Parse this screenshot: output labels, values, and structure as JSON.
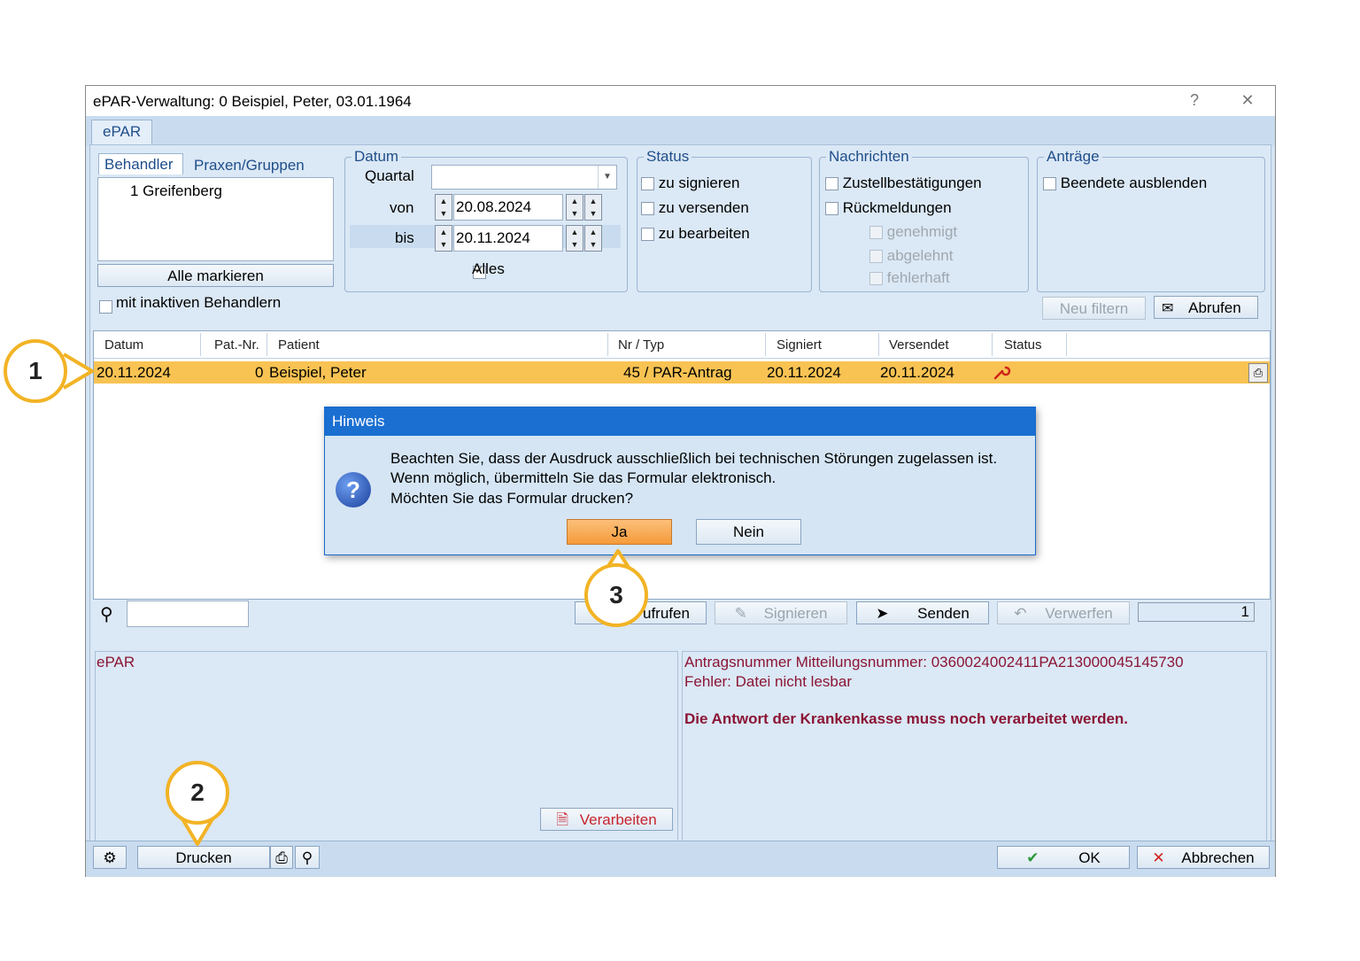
{
  "window": {
    "title": "ePAR-Verwaltung: 0 Beispiel, Peter, 03.01.1964",
    "help_glyph": "?",
    "close_glyph": "✕"
  },
  "tabs": {
    "main": "ePAR"
  },
  "left_panel": {
    "tab_behandler": "Behandler",
    "tab_praxen": "Praxen/Gruppen",
    "list_items": [
      "1 Greifenberg"
    ],
    "mark_all": "Alle markieren",
    "inactive_label": "mit inaktiven Behandlern"
  },
  "datum": {
    "legend": "Datum",
    "quartal_label": "Quartal",
    "quartal_value": "",
    "von_label": "von",
    "von_value": "20.08.2024",
    "bis_label": "bis",
    "bis_value": "20.11.2024",
    "alles_label": "Alles"
  },
  "status_group": {
    "legend": "Status",
    "items": [
      "zu signieren",
      "zu versenden",
      "zu bearbeiten"
    ]
  },
  "nachrichten": {
    "legend": "Nachrichten",
    "items": [
      "Zustellbestätigungen",
      "Rückmeldungen"
    ],
    "sub_items": [
      "genehmigt",
      "abgelehnt",
      "fehlerhaft"
    ]
  },
  "antraege": {
    "legend": "Anträge",
    "items": [
      "Beendete ausblenden"
    ]
  },
  "filter_buttons": {
    "neu_filtern": "Neu filtern",
    "abrufen": "Abrufen"
  },
  "table": {
    "headers": [
      "Datum",
      "Pat.-Nr.",
      "Patient",
      "Nr / Typ",
      "Signiert",
      "Versendet",
      "Status"
    ],
    "rows": [
      {
        "datum": "20.11.2024",
        "patnr": "0",
        "patient": "Beispiel, Peter",
        "nrtyp": "45 / PAR-Antrag",
        "signiert": "20.11.2024",
        "versendet": "20.11.2024",
        "status_icon": "wrench-icon"
      }
    ]
  },
  "dialog": {
    "title": "Hinweis",
    "lines": [
      "Beachten Sie, dass der Ausdruck ausschließlich bei technischen Störungen zugelassen ist.",
      "Wenn möglich, übermitteln Sie das Formular elektronisch.",
      "Möchten Sie das Formular drucken?"
    ],
    "yes": "Ja",
    "no": "Nein"
  },
  "action_bar": {
    "search_value": "",
    "aufrufen": "ufrufen",
    "signieren": "Signieren",
    "senden": "Senden",
    "verwerfen": "Verwerfen",
    "counter": "1"
  },
  "info_left": {
    "text": "ePAR",
    "verarbeiten": "Verarbeiten"
  },
  "info_right": {
    "line1": "Antragsnummer Mitteilungsnummer: 0360024002411PA213000045145730",
    "line2": "Fehler: Datei nicht lesbar",
    "bold": "Die Antwort der Krankenkasse muss noch verarbeitet werden."
  },
  "bottom_bar": {
    "drucken": "Drucken",
    "ok": "OK",
    "abbrechen": "Abbrechen"
  },
  "callouts": [
    "1",
    "2",
    "3"
  ],
  "colors": {
    "selected_row": "#f9c353",
    "dialog_title": "#1a6fd1",
    "callout": "#f2b325",
    "maroon": "#8b1535"
  }
}
